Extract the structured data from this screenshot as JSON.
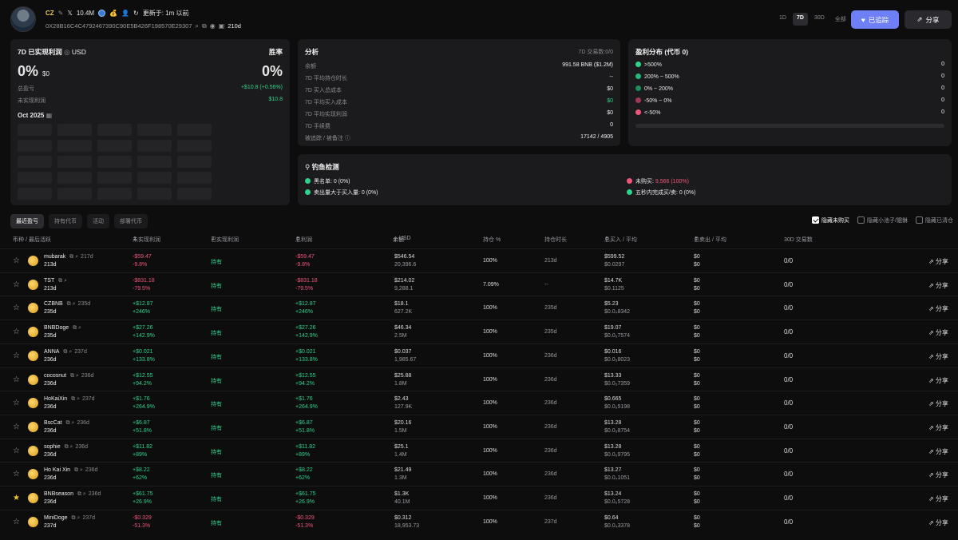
{
  "profile": {
    "name": "CZ",
    "x_followers": "10.4M",
    "updated": "更新于: 1m 以前",
    "address": "0X28B16C4C4792467390C90E5B426F198570E29307",
    "age": "210d"
  },
  "periods": [
    "1D",
    "7D",
    "30D",
    "全部"
  ],
  "buttons": {
    "follow": "已追踪",
    "share": "分享"
  },
  "pnl": {
    "title": "7D 已实现利润",
    "currency": "USD",
    "winrate_label": "胜率",
    "realized_pct": "0%",
    "realized_usd": "$0",
    "winrate": "0%",
    "total_label": "总盈亏",
    "total_value": "+$10.8 (+0.56%)",
    "unrealized_label": "未实现利润",
    "unrealized_value": "$10.8",
    "month": "Oct 2025"
  },
  "analysis": {
    "title": "分析",
    "sub": "7D 交易数:0/0",
    "rows": [
      {
        "k": "余额",
        "v": "991.58 BNB ($1.2M)"
      },
      {
        "k": "7D 平均持仓时长",
        "v": "--"
      },
      {
        "k": "7D 买入总成本",
        "v": "$0"
      },
      {
        "k": "7D 平均买入成本",
        "v": "$0"
      },
      {
        "k": "7D 平均实现利润",
        "v": "$0"
      },
      {
        "k": "7D 手续费",
        "v": "0"
      },
      {
        "k": "被追踪 / 被备注",
        "v": "17142 / 4905"
      }
    ]
  },
  "distribution": {
    "title": "盈利分布 (代币 0)",
    "rows": [
      {
        "k": ">500%",
        "v": "0",
        "c": "#2fd28a"
      },
      {
        "k": "200% ~ 500%",
        "v": "0",
        "c": "#27b679"
      },
      {
        "k": "0% ~ 200%",
        "v": "0",
        "c": "#1f8d5e"
      },
      {
        "k": "-50% ~ 0%",
        "v": "0",
        "c": "#9e3a55"
      },
      {
        "k": "<-50%",
        "v": "0",
        "c": "#f0567a"
      }
    ]
  },
  "phishing": {
    "title": "钓鱼检测",
    "items": [
      {
        "k": "黑名单:",
        "v": "0 (0%)",
        "c": "#2fd28a"
      },
      {
        "k": "未购买:",
        "v": "9,566 (100%)",
        "c": "#f0567a"
      },
      {
        "k": "卖出量大于买入量:",
        "v": "0 (0%)",
        "c": "#2fd28a"
      },
      {
        "k": "五秒内完成买/卖:",
        "v": "0 (0%)",
        "c": "#2fd28a"
      }
    ]
  },
  "tabs": [
    "最近盈亏",
    "持有代币",
    "活动",
    "部署代币"
  ],
  "checks": [
    "隐藏未购买",
    "隐藏小池子/貔貅",
    "隐藏已清仓"
  ],
  "columns": [
    "币种 / 最后活跃",
    "未实现利润",
    "已实现利润",
    "总利润",
    "余额",
    "USD",
    "持仓 %",
    "持仓时长",
    "总买入 / 平均",
    "总卖出 / 平均",
    "30D 交易数"
  ],
  "share_label": "分享",
  "rows": [
    {
      "name": "mubarak",
      "ago": "217d",
      "age": "213d",
      "u1": "-$59.47",
      "u2": "-9.8%",
      "real": "持有",
      "t1": "-$59.47",
      "t2": "-9.8%",
      "b1": "$546.54",
      "b2": "20,396.6",
      "hold": "100%",
      "dur": "213d",
      "buy1": "$599.52",
      "buy2": "$0.0297",
      "s1": "$0",
      "s2": "$0",
      "tx": "0/0",
      "neg": true,
      "fav": false
    },
    {
      "name": "TST",
      "ago": "",
      "age": "213d",
      "u1": "-$831.18",
      "u2": "-79.5%",
      "real": "持有",
      "t1": "-$831.18",
      "t2": "-79.5%",
      "b1": "$214.02",
      "b2": "9,288.1",
      "hold": "7.09%",
      "dur": "--",
      "buy1": "$14.7K",
      "buy2": "$0.1125",
      "s1": "$0",
      "s2": "$0",
      "tx": "0/0",
      "neg": true,
      "fav": false
    },
    {
      "name": "CZBNB",
      "ago": "235d",
      "age": "235d",
      "u1": "+$12.87",
      "u2": "+246%",
      "real": "持有",
      "t1": "+$12.87",
      "t2": "+246%",
      "b1": "$18.1",
      "b2": "627.2K",
      "hold": "100%",
      "dur": "235d",
      "buy1": "$5.23",
      "buy2": "$0.0₄8342",
      "s1": "$0",
      "s2": "$0",
      "tx": "0/0",
      "neg": false,
      "fav": false
    },
    {
      "name": "BNBDoge",
      "ago": "",
      "age": "235d",
      "u1": "+$27.26",
      "u2": "+142.9%",
      "real": "持有",
      "t1": "+$27.26",
      "t2": "+142.9%",
      "b1": "$46.34",
      "b2": "2.5M",
      "hold": "100%",
      "dur": "235d",
      "buy1": "$19.07",
      "buy2": "$0.0₅7574",
      "s1": "$0",
      "s2": "$0",
      "tx": "0/0",
      "neg": false,
      "fav": false
    },
    {
      "name": "ANNA",
      "ago": "237d",
      "age": "236d",
      "u1": "+$0.021",
      "u2": "+133.8%",
      "real": "持有",
      "t1": "+$0.021",
      "t2": "+133.8%",
      "b1": "$0.037",
      "b2": "1,985.67",
      "hold": "100%",
      "dur": "236d",
      "buy1": "$0.016",
      "buy2": "$0.0₅8023",
      "s1": "$0",
      "s2": "$0",
      "tx": "0/0",
      "neg": false,
      "fav": false
    },
    {
      "name": "cocosnut",
      "ago": "236d",
      "age": "236d",
      "u1": "+$12.55",
      "u2": "+94.2%",
      "real": "持有",
      "t1": "+$12.55",
      "t2": "+94.2%",
      "b1": "$25.88",
      "b2": "1.8M",
      "hold": "100%",
      "dur": "236d",
      "buy1": "$13.33",
      "buy2": "$0.0₅7359",
      "s1": "$0",
      "s2": "$0",
      "tx": "0/0",
      "neg": false,
      "fav": false
    },
    {
      "name": "HoKaiXin",
      "ago": "237d",
      "age": "236d",
      "u1": "+$1.76",
      "u2": "+264.9%",
      "real": "持有",
      "t1": "+$1.76",
      "t2": "+264.9%",
      "b1": "$2.43",
      "b2": "127.9K",
      "hold": "100%",
      "dur": "236d",
      "buy1": "$0.665",
      "buy2": "$0.0₅5198",
      "s1": "$0",
      "s2": "$0",
      "tx": "0/0",
      "neg": false,
      "fav": false
    },
    {
      "name": "BscCat",
      "ago": "236d",
      "age": "236d",
      "u1": "+$6.87",
      "u2": "+51.8%",
      "real": "持有",
      "t1": "+$6.87",
      "t2": "+51.8%",
      "b1": "$20.16",
      "b2": "1.5M",
      "hold": "100%",
      "dur": "236d",
      "buy1": "$13.28",
      "buy2": "$0.0₅8754",
      "s1": "$0",
      "s2": "$0",
      "tx": "0/0",
      "neg": false,
      "fav": false
    },
    {
      "name": "sophie",
      "ago": "236d",
      "age": "236d",
      "u1": "+$11.82",
      "u2": "+89%",
      "real": "持有",
      "t1": "+$11.82",
      "t2": "+89%",
      "b1": "$25.1",
      "b2": "1.4M",
      "hold": "100%",
      "dur": "236d",
      "buy1": "$13.28",
      "buy2": "$0.0₅9795",
      "s1": "$0",
      "s2": "$0",
      "tx": "0/0",
      "neg": false,
      "fav": false
    },
    {
      "name": "Ho Kai Xin",
      "ago": "236d",
      "age": "236d",
      "u1": "+$8.22",
      "u2": "+62%",
      "real": "持有",
      "t1": "+$8.22",
      "t2": "+62%",
      "b1": "$21.49",
      "b2": "1.3M",
      "hold": "100%",
      "dur": "236d",
      "buy1": "$13.27",
      "buy2": "$0.0₄1051",
      "s1": "$0",
      "s2": "$0",
      "tx": "0/0",
      "neg": false,
      "fav": false
    },
    {
      "name": "BNBseason",
      "ago": "236d",
      "age": "236d",
      "u1": "+$61.75",
      "u2": "+26.9%",
      "real": "持有",
      "t1": "+$61.75",
      "t2": "+26.9%",
      "b1": "$1.3K",
      "b2": "40.1M",
      "hold": "100%",
      "dur": "236d",
      "buy1": "$13.24",
      "buy2": "$0.0₅5728",
      "s1": "$0",
      "s2": "$0",
      "tx": "0/0",
      "neg": false,
      "fav": true
    },
    {
      "name": "MiniDoge",
      "ago": "237d",
      "age": "237d",
      "u1": "-$0.329",
      "u2": "-51.3%",
      "real": "持有",
      "t1": "-$0.329",
      "t2": "-51.3%",
      "b1": "$0.312",
      "b2": "18,953.73",
      "hold": "100%",
      "dur": "237d",
      "buy1": "$0.64",
      "buy2": "$0.0₄3378",
      "s1": "$0",
      "s2": "$0",
      "tx": "0/0",
      "neg": true,
      "fav": false
    }
  ]
}
